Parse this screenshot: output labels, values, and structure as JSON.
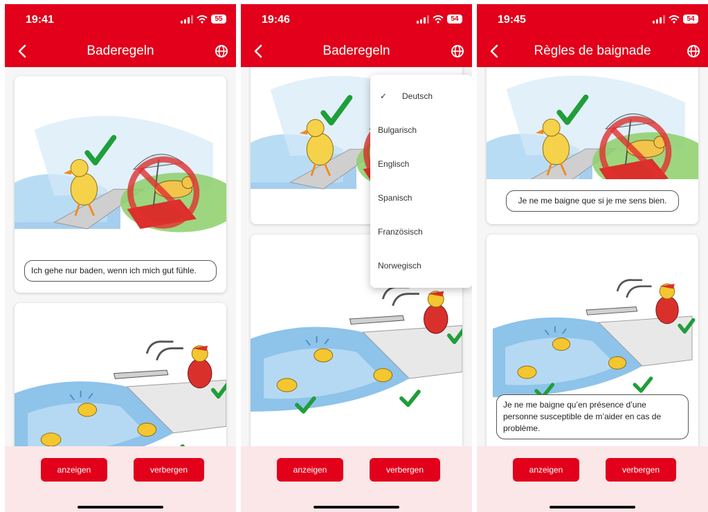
{
  "colors": {
    "brand_red": "#e2001a",
    "bottom_bar": "#fbe6e8",
    "water": "#7fb8e3",
    "grass": "#7cc35a",
    "duck": "#f4c62f",
    "check": "#1f9e3a"
  },
  "icons": {
    "back": "chevron-left-icon",
    "language": "globe-icon",
    "selected": "check-icon"
  },
  "screens": [
    {
      "time": "19:41",
      "battery": "55",
      "title": "Baderegeln",
      "captions": [
        "Ich gehe nur baden, wenn ich mich gut fühle."
      ],
      "buttons": {
        "show": "anzeigen",
        "hide": "verbergen"
      }
    },
    {
      "time": "19:46",
      "battery": "54",
      "title": "Baderegeln",
      "language_menu": {
        "selected": "Deutsch",
        "options": [
          "Deutsch",
          "Bulgarisch",
          "Englisch",
          "Spanisch",
          "Französisch",
          "Norwegisch"
        ]
      },
      "buttons": {
        "show": "anzeigen",
        "hide": "verbergen"
      }
    },
    {
      "time": "19:45",
      "battery": "54",
      "title": "Règles de baignade",
      "captions": [
        "Je ne me baigne que si je me sens bien.",
        "Je ne me baigne qu’en présence d’une personne susceptible de m’aider en cas de problème."
      ],
      "buttons": {
        "show": "anzeigen",
        "hide": "verbergen"
      }
    }
  ]
}
